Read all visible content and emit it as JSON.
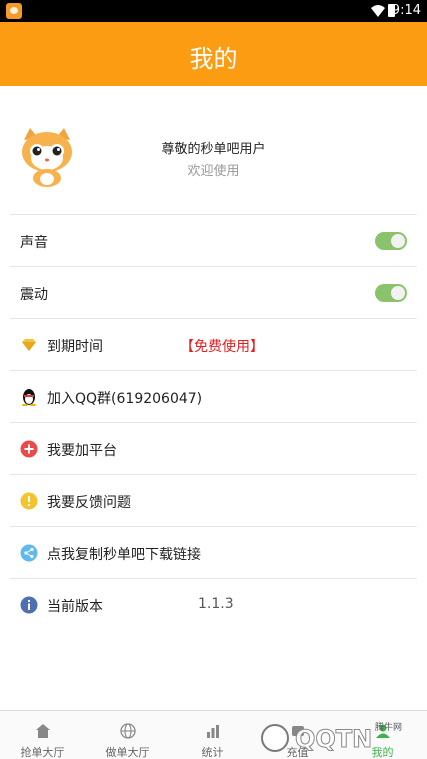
{
  "statusbar": {
    "time": "9:14"
  },
  "header": {
    "title": "我的"
  },
  "profile": {
    "username": "尊敬的秒单吧用户",
    "subtitle": "欢迎使用"
  },
  "menu": {
    "sound": {
      "label": "声音",
      "toggle_on": true
    },
    "vibrate": {
      "label": "震动",
      "toggle_on": true
    },
    "expire": {
      "label": "到期时间",
      "value": "【免费使用】"
    },
    "qq": {
      "label": "加入QQ群(619206047)"
    },
    "add_platform": {
      "label": "我要加平台"
    },
    "feedback": {
      "label": "我要反馈问题"
    },
    "copy_link": {
      "label": "点我复制秒单吧下载链接"
    },
    "version": {
      "label": "当前版本",
      "value": "1.1.3"
    }
  },
  "tabs": [
    {
      "label": "抢单大厅",
      "icon": "home-icon"
    },
    {
      "label": "做单大厅",
      "icon": "globe-icon"
    },
    {
      "label": "统计",
      "icon": "bar-chart-icon"
    },
    {
      "label": "充值",
      "icon": "recharge-icon"
    },
    {
      "label": "我的",
      "icon": "person-icon"
    }
  ],
  "watermark": {
    "text": "QQTN",
    "subtext": "腾牛网"
  },
  "colors": {
    "accent": "#fb9c13",
    "toggle": "#8ac36b",
    "highlight": "#e02020"
  }
}
